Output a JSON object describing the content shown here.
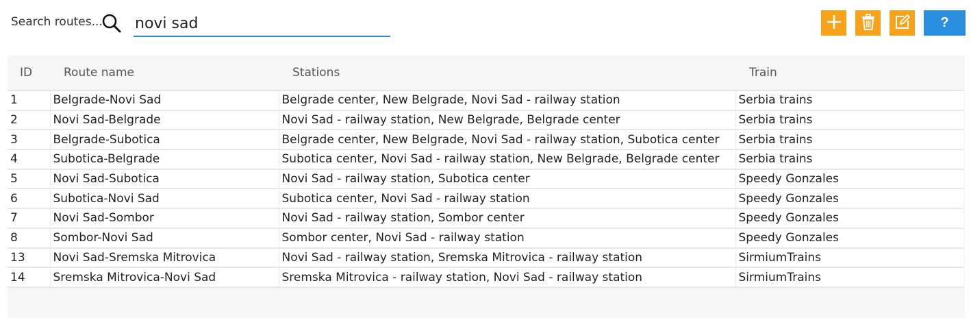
{
  "search": {
    "label": "Search routes...",
    "value": "novi sad",
    "icon": "search-icon"
  },
  "toolbar": {
    "add_icon": "plus-icon",
    "delete_icon": "trash-icon",
    "edit_icon": "edit-icon",
    "help_label": "?",
    "accent_orange": "#f7a21b",
    "accent_blue": "#2b8fe0"
  },
  "table": {
    "headers": {
      "id": "ID",
      "route_name": "Route name",
      "stations": "Stations",
      "train": "Train"
    },
    "rows": [
      {
        "id": "1",
        "route": "Belgrade-Novi Sad",
        "stations": "Belgrade center, New Belgrade, Novi Sad - railway station",
        "train": "Serbia trains"
      },
      {
        "id": "2",
        "route": "Novi Sad-Belgrade",
        "stations": "Novi Sad - railway station, New Belgrade, Belgrade center",
        "train": "Serbia trains"
      },
      {
        "id": "3",
        "route": "Belgrade-Subotica",
        "stations": "Belgrade center, New Belgrade, Novi Sad - railway station, Subotica center",
        "train": "Serbia trains"
      },
      {
        "id": "4",
        "route": "Subotica-Belgrade",
        "stations": "Subotica center, Novi Sad - railway station, New Belgrade, Belgrade center",
        "train": "Serbia trains"
      },
      {
        "id": "5",
        "route": "Novi Sad-Subotica",
        "stations": "Novi Sad - railway station, Subotica center",
        "train": "Speedy Gonzales"
      },
      {
        "id": "6",
        "route": "Subotica-Novi Sad",
        "stations": "Subotica center, Novi Sad - railway station",
        "train": "Speedy Gonzales"
      },
      {
        "id": "7",
        "route": "Novi Sad-Sombor",
        "stations": "Novi Sad - railway station, Sombor center",
        "train": "Speedy Gonzales"
      },
      {
        "id": "8",
        "route": "Sombor-Novi Sad",
        "stations": "Sombor center, Novi Sad - railway station",
        "train": "Speedy Gonzales"
      },
      {
        "id": "13",
        "route": "Novi Sad-Sremska Mitrovica",
        "stations": "Novi Sad - railway station, Sremska Mitrovica - railway station",
        "train": "SirmiumTrains"
      },
      {
        "id": "14",
        "route": "Sremska Mitrovica-Novi Sad",
        "stations": "Sremska Mitrovica - railway station, Novi Sad - railway station",
        "train": "SirmiumTrains"
      }
    ]
  }
}
